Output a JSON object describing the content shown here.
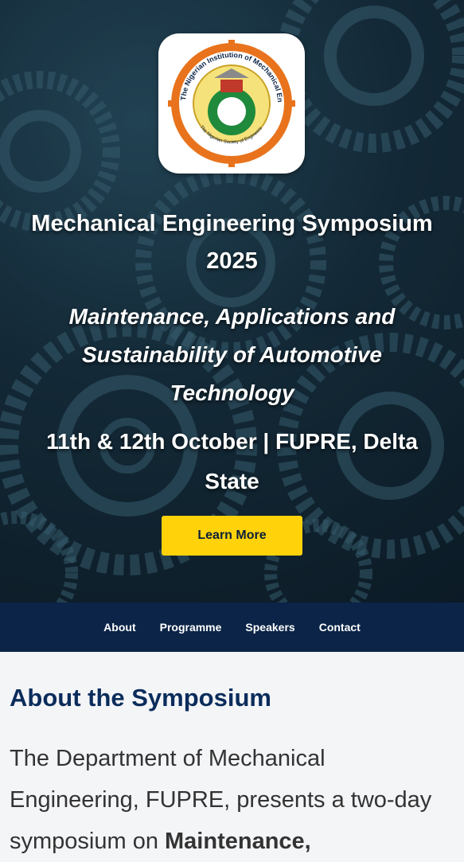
{
  "hero": {
    "logo": {
      "outer_text": "The Nigerian Institution of Mechanical Engineers",
      "inner_text": "The Nigerian Society of Engineers",
      "colors": {
        "ring": "#e8731c",
        "inner": "#1f8a3c"
      }
    },
    "title": "Mechanical Engineering Symposium 2025",
    "subtitle": "Maintenance, Applications and Sustainability of Automotive Technology",
    "date_venue": "11th & 12th October | FUPRE, Delta State",
    "cta_label": "Learn More"
  },
  "nav": {
    "items": [
      "About",
      "Programme",
      "Speakers",
      "Contact"
    ]
  },
  "about": {
    "heading": "About the Symposium",
    "body_prefix": "The Department of Mechanical Engineering, FUPRE, presents a two-day symposium on ",
    "body_bold": "Maintenance,"
  },
  "colors": {
    "cta": "#ffd20a",
    "nav_bg": "#0b2447",
    "heading": "#0b2d5c"
  }
}
